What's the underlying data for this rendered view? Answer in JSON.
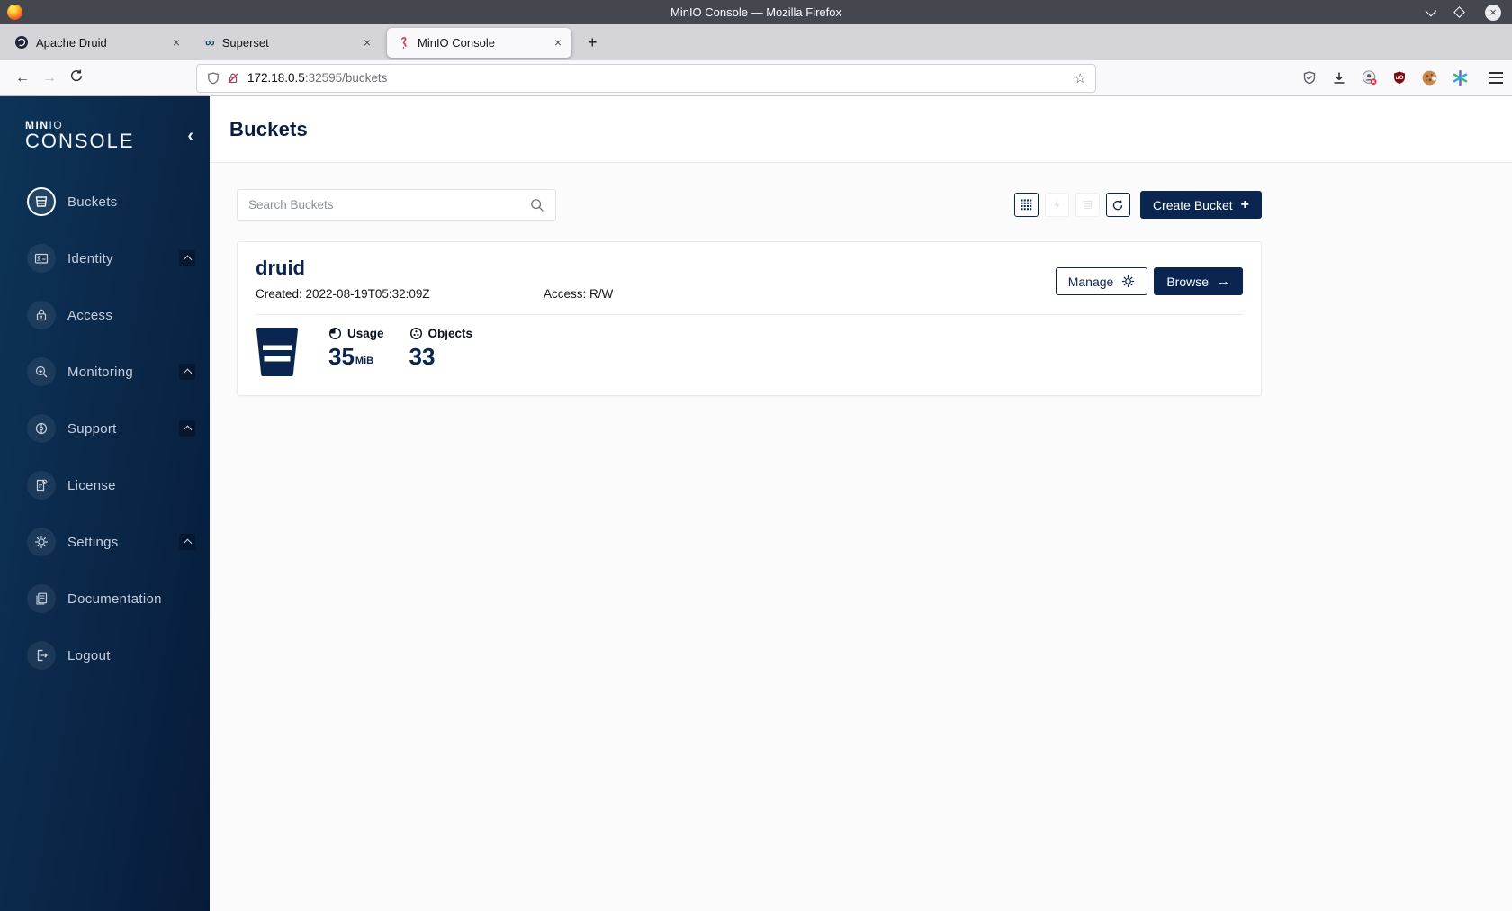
{
  "window": {
    "title": "MinIO Console — Mozilla Firefox"
  },
  "browser": {
    "tabs": [
      {
        "label": "Apache Druid"
      },
      {
        "label": "Superset"
      },
      {
        "label": "MinIO Console"
      }
    ],
    "url": {
      "host": "172.18.0.5",
      "rest": ":32595/buckets"
    }
  },
  "icons": {
    "close_tab": "×",
    "new_tab": "+",
    "back": "←",
    "forward": "→",
    "star": "☆",
    "infinity": "∞",
    "window_close": "×",
    "sidebar_collapse": "‹",
    "browse_arrow": "→",
    "create_plus": "+"
  },
  "sidebar": {
    "logo": {
      "brand_bold": "MIN",
      "brand_light": "IO",
      "product": "CONSOLE"
    },
    "items": [
      {
        "label": "Buckets"
      },
      {
        "label": "Identity"
      },
      {
        "label": "Access"
      },
      {
        "label": "Monitoring"
      },
      {
        "label": "Support"
      },
      {
        "label": "License"
      },
      {
        "label": "Settings"
      },
      {
        "label": "Documentation"
      }
    ],
    "logout_label": "Logout"
  },
  "page": {
    "title": "Buckets"
  },
  "toolbar": {
    "search_placeholder": "Search Buckets",
    "create_button_label": "Create Bucket"
  },
  "bucket_card": {
    "name": "druid",
    "created": "Created: 2022-08-19T05:32:09Z",
    "access": "Access: R/W",
    "manage_label": "Manage",
    "browse_label": "Browse",
    "usage_label": "Usage",
    "usage_value": "35",
    "usage_unit": "MiB",
    "objects_label": "Objects",
    "objects_value": "33"
  }
}
